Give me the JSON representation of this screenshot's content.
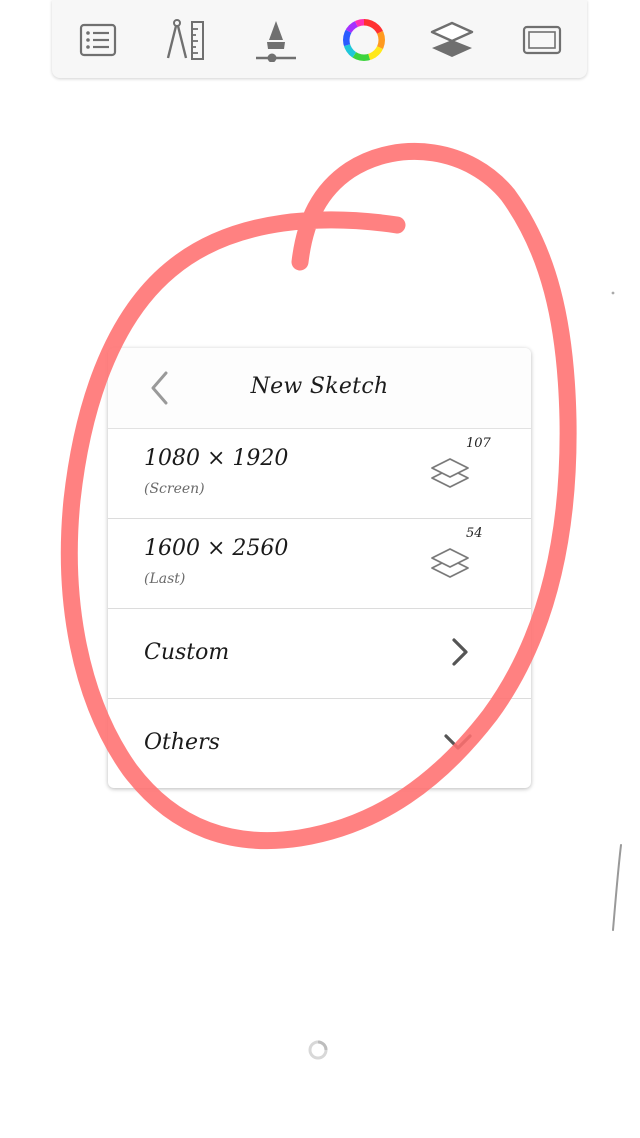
{
  "toolbar": {
    "tools": [
      {
        "name": "list-icon"
      },
      {
        "name": "ruler-compass-icon"
      },
      {
        "name": "brush-size-icon"
      },
      {
        "name": "color-wheel-icon"
      },
      {
        "name": "layers-icon"
      },
      {
        "name": "fullscreen-icon"
      }
    ]
  },
  "dialog": {
    "title": "New Sketch",
    "rows": [
      {
        "size": "1080 × 1920",
        "note": "(Screen)",
        "layers": "107"
      },
      {
        "size": "1600 × 2560",
        "note": "(Last)",
        "layers": "54"
      }
    ],
    "custom_label": "Custom",
    "others_label": "Others"
  },
  "colors": {
    "annotation": "#ff6f6f",
    "icon_gray": "#6f6f6f"
  }
}
